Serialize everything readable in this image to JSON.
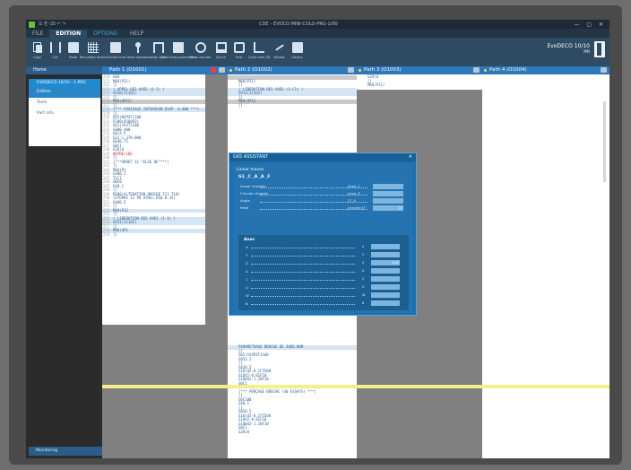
{
  "window": {
    "quick_access": "☰ ⎘ ⌫ ↶ ↷",
    "title": "CDE – EVOCO MINI-COLO-PRG-1/00",
    "controls": "— ▢ ✕"
  },
  "ribbon": {
    "tabs": [
      {
        "label": "FILE",
        "active": false,
        "accent": false
      },
      {
        "label": "EDITION",
        "active": true,
        "accent": false
      },
      {
        "label": "OPTIONS",
        "active": false,
        "accent": true
      },
      {
        "label": "HELP",
        "active": false,
        "accent": false
      }
    ],
    "buttons": [
      {
        "label": "Copy",
        "icon": "copy-icon"
      },
      {
        "label": "Cut",
        "icon": "cut-icon"
      },
      {
        "label": "Paste",
        "icon": "paste-icon"
      },
      {
        "label": "Renumber blocks",
        "icon": "grid-icon"
      },
      {
        "label": "Format line",
        "icon": "disk-icon"
      },
      {
        "label": "Create operation",
        "icon": "pin-icon"
      },
      {
        "label": "Align sync",
        "icon": "bars-icon"
      },
      {
        "label": "Machining parameters",
        "icon": "document-icon"
      },
      {
        "label": "Parts counter",
        "icon": "gear-icon"
      },
      {
        "label": "Synch",
        "icon": "screen-icon"
      },
      {
        "label": "Find",
        "icon": "magnifier-icon"
      },
      {
        "label": "Cycle time 3D",
        "icon": "chart-icon"
      },
      {
        "label": "Wizard",
        "icon": "wave-icon"
      },
      {
        "label": "Library",
        "icon": "library-icon"
      }
    ],
    "brand": "EvoDECO 10/10",
    "brand_sub": "MM"
  },
  "sidebar": {
    "home": "Home",
    "file": "EVODECO 10/10 - 1.PRG",
    "items": [
      {
        "label": "Edition",
        "selected": true
      },
      {
        "label": "Tools",
        "selected": false
      },
      {
        "label": "Part info",
        "selected": false
      }
    ],
    "footer": "Monitoring"
  },
  "paths": [
    {
      "label": "Path 1 (O1001)",
      "dot": false
    },
    {
      "label": "Path 2 (O1002)",
      "dot": true
    },
    {
      "label": "Path 3 (O1003)",
      "dot": true
    },
    {
      "label": "Path 4 (O1004)",
      "dot": true
    }
  ],
  "path1_lines": [
    {
      "n": "220",
      "t": "G04",
      "s": ""
    },
    {
      "n": "221",
      "t": "M60(P11)",
      "s": ""
    },
    {
      "n": "222",
      "t": "[]",
      "s": ""
    },
    {
      "n": "223",
      "t": "( APPEL DES AXES (1-1) )",
      "s": "hl"
    },
    {
      "n": "224",
      "t": "G910(1C1Q2)",
      "s": "hl"
    },
    {
      "n": "225",
      "t": "[]",
      "s": ""
    },
    {
      "n": "226",
      "t": "M60(4P12)",
      "s": "gr"
    },
    {
      "n": "227",
      "t": "[]",
      "s": ""
    },
    {
      "n": "228",
      "t": "(*** FRAISAGE INTERSEGN DIAP. 0.000 ***)",
      "s": "hl"
    },
    {
      "n": "229",
      "t": "[]",
      "s": ""
    },
    {
      "n": "230",
      "t": "G65(N3P4T1100",
      "s": ""
    },
    {
      "n": "231",
      "t": "P200(0500P3)",
      "s": ""
    },
    {
      "n": "232",
      "t": "G61(1V4T1100",
      "s": ""
    },
    {
      "n": "233",
      "t": "S800 400",
      "s": ""
    },
    {
      "n": "234",
      "t": "G0(X-5",
      "s": ""
    },
    {
      "n": "235",
      "t": "G12-1.370-000",
      "s": ""
    },
    {
      "n": "236",
      "t": "G640.75",
      "s": ""
    },
    {
      "n": "237",
      "t": "G0C1",
      "s": ""
    },
    {
      "n": "238",
      "t": "G28(0",
      "s": ""
    },
    {
      "n": "239",
      "t": "HOTRE(1QS",
      "s": "red"
    },
    {
      "n": "240",
      "t": "[]",
      "s": ""
    },
    {
      "n": "241",
      "t": "(***ARRET S1 \"ELSE RE\"***)",
      "s": ""
    },
    {
      "n": "242",
      "t": "[]",
      "s": ""
    },
    {
      "n": "243",
      "t": "M60(P1",
      "s": ""
    },
    {
      "n": "244",
      "t": "G400.1",
      "s": ""
    },
    {
      "n": "245",
      "t": "T1C1",
      "s": ""
    },
    {
      "n": "246",
      "t": "G0C0",
      "s": ""
    },
    {
      "n": "247",
      "t": "G40.1",
      "s": ""
    },
    {
      "n": "248",
      "t": "[]",
      "s": ""
    },
    {
      "n": "249",
      "t": "M200(ALTERATION BROCHE TC1 T10)",
      "s": ""
    },
    {
      "n": "250",
      "t": "(STOPHS 12 PO ATHS= DS0 0.35)",
      "s": ""
    },
    {
      "n": "251",
      "t": "G400.5",
      "s": ""
    },
    {
      "n": "252",
      "t": "[]",
      "s": ""
    },
    {
      "n": "253",
      "t": "M60(P12",
      "s": "hl"
    },
    {
      "n": "254",
      "t": "[]",
      "s": ""
    },
    {
      "n": "255",
      "t": "( LIBERATION DES AXES (1-1) )",
      "s": "hl"
    },
    {
      "n": "256",
      "t": "G911(1C1Q2)",
      "s": "hl"
    },
    {
      "n": "257",
      "t": "[]",
      "s": ""
    },
    {
      "n": "258",
      "t": "M60(4P1",
      "s": "hl"
    },
    {
      "n": "259",
      "t": "[]",
      "s": ""
    }
  ],
  "path2_top": [
    {
      "n": "",
      "t": "",
      "s": "gr"
    },
    {
      "n": "",
      "t": "M60(P11)",
      "s": ""
    },
    {
      "n": "",
      "t": "[]",
      "s": ""
    },
    {
      "n": "",
      "t": "( LIBERATION DES AXES (1-C1) )",
      "s": "hl"
    },
    {
      "n": "",
      "t": "G911(1C1Q2)",
      "s": "hl"
    },
    {
      "n": "",
      "t": "[]",
      "s": ""
    },
    {
      "n": "",
      "t": "M60(4P12",
      "s": "gr"
    },
    {
      "n": "",
      "t": "[]",
      "s": ""
    }
  ],
  "path2_bottom": [
    {
      "n": "",
      "t": "PARAMETRAGE BROCHE DE SUBS.NUM",
      "s": "hl"
    },
    {
      "n": "",
      "t": "[]",
      "s": ""
    },
    {
      "n": "",
      "t": "G65(1V4P3T1100",
      "s": ""
    },
    {
      "n": "",
      "t": "G953.2",
      "s": ""
    },
    {
      "n": "",
      "t": "[]",
      "s": ""
    },
    {
      "n": "",
      "t": "G820.5",
      "s": ""
    },
    {
      "n": "",
      "t": "G10(4Z-0.1F5500",
      "s": ""
    },
    {
      "n": "",
      "t": "G1042-0.01F10",
      "s": ""
    },
    {
      "n": "",
      "t": "G10042-1.20F10",
      "s": ""
    },
    {
      "n": "",
      "t": "G0C1",
      "s": ""
    },
    {
      "n": "",
      "t": "[]",
      "s": ""
    },
    {
      "n": "",
      "t": "(*** PERÇAGE BROCHE (40 ESSAYS) ***)",
      "s": ""
    },
    {
      "n": "",
      "t": "[]",
      "s": ""
    },
    {
      "n": "",
      "t": "G0C100",
      "s": ""
    },
    {
      "n": "",
      "t": "G40.1",
      "s": ""
    },
    {
      "n": "",
      "t": "[]",
      "s": ""
    },
    {
      "n": "",
      "t": "G820.5",
      "s": ""
    },
    {
      "n": "",
      "t": "G10(4Z-0.1F5500",
      "s": ""
    },
    {
      "n": "",
      "t": "G1042-0.01F10",
      "s": ""
    },
    {
      "n": "",
      "t": "G10042-1.20F10",
      "s": ""
    },
    {
      "n": "",
      "t": "G0C1",
      "s": ""
    },
    {
      "n": "",
      "t": "G28(0",
      "s": ""
    }
  ],
  "path3_lines": [
    {
      "n": "",
      "t": "G28(0",
      "s": ""
    },
    {
      "n": "",
      "t": "[]",
      "s": ""
    },
    {
      "n": "",
      "t": "M60(P11)",
      "s": ""
    }
  ],
  "dialog": {
    "title": "G65 ASSISTANT",
    "section": "Linear moves",
    "gcode": "G1 _C _A _A _F",
    "fields": [
      {
        "label": "Linear chamfer",
        "unit": "[mm]  ,C",
        "value": ""
      },
      {
        "label": "Circular chamfer",
        "unit": "[mm]  ,R",
        "value": ""
      },
      {
        "label": "Angle",
        "unit": "[°]  ,A",
        "value": ""
      },
      {
        "label": "Feed",
        "unit": "[mm/min]  F",
        "value": "10"
      }
    ],
    "axes_title": "Axes",
    "axes": [
      {
        "label": "X",
        "unit": "X",
        "value": ""
      },
      {
        "label": "Y",
        "unit": "Y",
        "value": ""
      },
      {
        "label": "Z",
        "unit": "Z",
        "value": "-1.20"
      },
      {
        "label": "A",
        "unit": "A",
        "value": ""
      },
      {
        "label": "C",
        "unit": "C",
        "value": ""
      },
      {
        "label": "U",
        "unit": "U",
        "value": ""
      },
      {
        "label": "W",
        "unit": "W",
        "value": ""
      },
      {
        "label": "B",
        "unit": "B",
        "value": ""
      }
    ]
  },
  "colors": {
    "accent": "#2c78ba",
    "ribbon": "#2f4a63",
    "highlight_line": "#f4ef8a"
  }
}
